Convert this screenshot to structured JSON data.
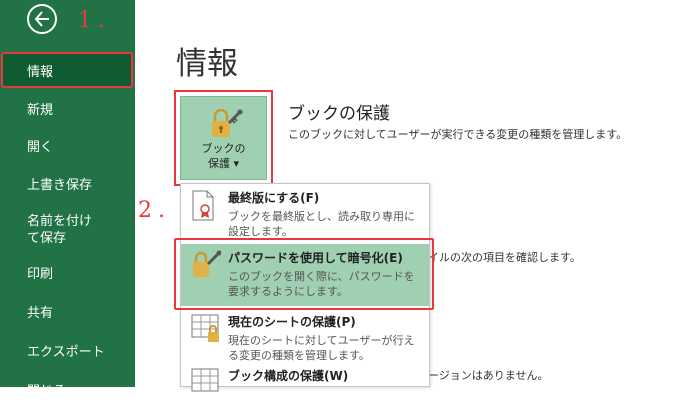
{
  "colors": {
    "sidebar_bg": "#217346",
    "sidebar_selected_bg": "#0f5c32",
    "highlight_red": "#e8383d",
    "menu_highlight": "#9fd0b2",
    "lock_gold": "#e2b146"
  },
  "steps": {
    "step1": "1.",
    "step2": "2."
  },
  "sidebar": {
    "back_icon": "back-arrow-icon",
    "items": [
      {
        "label": "情報"
      },
      {
        "label": "新規"
      },
      {
        "label": "開く"
      },
      {
        "label": "上書き保存"
      },
      {
        "label": "名前を付けて保存"
      },
      {
        "label": "印刷"
      },
      {
        "label": "共有"
      },
      {
        "label": "エクスポート"
      },
      {
        "label": "閉じる"
      }
    ]
  },
  "main": {
    "title": "情報",
    "protect_button": {
      "line1": "ブックの",
      "line2": "保護 ▾",
      "icon": "lock-key-icon"
    },
    "section_title": "ブックの保護",
    "section_desc": "このブックに対してユーザーが実行できる変更の種類を管理します。",
    "bg_text_1": "イルの次の項目を確認します。",
    "bg_text_2": "ージョンはありません。"
  },
  "dropdown": {
    "items": [
      {
        "title": "最終版にする(F)",
        "desc": "ブックを最終版とし、読み取り専用に設定します。",
        "icon": "document-ribbon-icon"
      },
      {
        "title": "パスワードを使用して暗号化(E)",
        "desc": "このブックを開く際に、パスワードを要求するようにします。",
        "icon": "lock-key-icon"
      },
      {
        "title": "現在のシートの保護(P)",
        "desc": "現在のシートに対してユーザーが行える変更の種類を管理します。",
        "icon": "sheet-lock-icon"
      },
      {
        "title": "ブック構成の保護(W)",
        "desc": "",
        "icon": "workbook-structure-icon"
      }
    ]
  }
}
